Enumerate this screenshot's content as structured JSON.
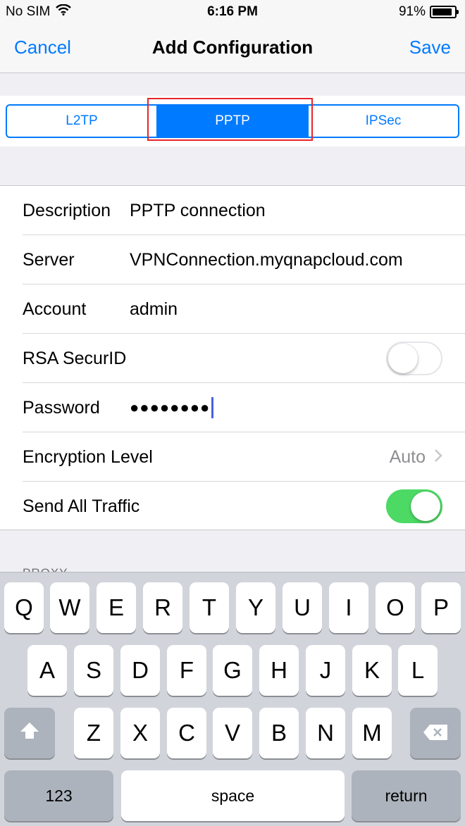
{
  "status_bar": {
    "carrier": "No SIM",
    "time": "6:16 PM",
    "battery_percent": "91%",
    "battery_level": 0.91
  },
  "nav": {
    "cancel": "Cancel",
    "title": "Add Configuration",
    "save": "Save"
  },
  "segments": {
    "items": [
      "L2TP",
      "PPTP",
      "IPSec"
    ],
    "selected": "PPTP"
  },
  "form": {
    "description": {
      "label": "Description",
      "value": "PPTP connection"
    },
    "server": {
      "label": "Server",
      "value": "VPNConnection.myqnapcloud.com"
    },
    "account": {
      "label": "Account",
      "value": "admin"
    },
    "rsa": {
      "label": "RSA SecurID",
      "on": false
    },
    "password": {
      "label": "Password",
      "value": "●●●●●●●●"
    },
    "encryption": {
      "label": "Encryption Level",
      "value": "Auto"
    },
    "send_all": {
      "label": "Send All Traffic",
      "on": true
    }
  },
  "proxy_header": "PROXY",
  "keyboard": {
    "row1": [
      "Q",
      "W",
      "E",
      "R",
      "T",
      "Y",
      "U",
      "I",
      "O",
      "P"
    ],
    "row2": [
      "A",
      "S",
      "D",
      "F",
      "G",
      "H",
      "J",
      "K",
      "L"
    ],
    "row3": [
      "Z",
      "X",
      "C",
      "V",
      "B",
      "N",
      "M"
    ],
    "numbers": "123",
    "space": "space",
    "return": "return"
  },
  "colors": {
    "accent": "#007aff",
    "toggle_on": "#4cd964",
    "highlight": "#e8242a"
  },
  "icons": {
    "wifi": "wifi-icon",
    "shift": "shift-icon",
    "delete": "delete-icon",
    "chevron": "chevron-right-icon"
  }
}
